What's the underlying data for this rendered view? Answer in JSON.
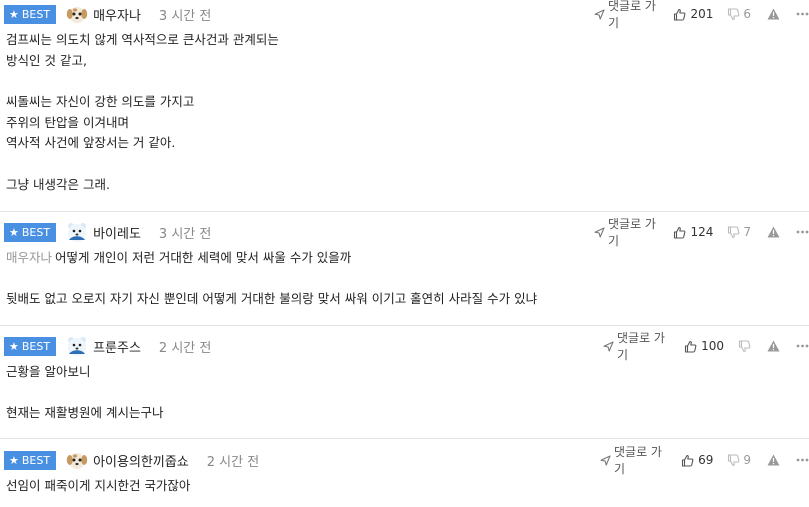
{
  "labels": {
    "best": "BEST",
    "reply": "댓글로 가기"
  },
  "comments": [
    {
      "nick": "매우자나",
      "time": "3 시간 전",
      "avatar": "puppy-avatar",
      "up": "201",
      "down": "6",
      "lines": [
        "검프씨는 의도치 않게 역사적으로 큰사건과 관계되는",
        "방식인 것 같고,",
        "",
        "씨돌씨는 자신이 강한 의도를 가지고",
        "주위의 탄압을 이겨내며",
        "역사적 사건에 앞장서는 거 같아.",
        "",
        "그냥 내생각은 그래."
      ]
    },
    {
      "nick": "바이레도",
      "time": "3 시간 전",
      "avatar": "bear-avatar",
      "up": "124",
      "down": "7",
      "mention": "매우자나",
      "lines": [
        "어떻게 개인이 저런 거대한 세력에 맞서 싸울 수가 있을까",
        "",
        "뒷배도 없고 오로지 자기 자신 뿐인데 어떻게 거대한 불의랑 맞서 싸워 이기고 홀연히 사라질 수가 있냐"
      ]
    },
    {
      "nick": "프룬주스",
      "time": "2 시간 전",
      "avatar": "bear-avatar",
      "up": "100",
      "down": "",
      "lines": [
        "근황을 알아보니",
        "",
        "현재는 재활병원에 계시는구나"
      ]
    },
    {
      "nick": "아이용의한끼줍쇼",
      "time": "2 시간 전",
      "avatar": "puppy-avatar",
      "up": "69",
      "down": "9",
      "lines": [
        "선임이 패죽이게 지시한건 국가잖아"
      ]
    }
  ]
}
